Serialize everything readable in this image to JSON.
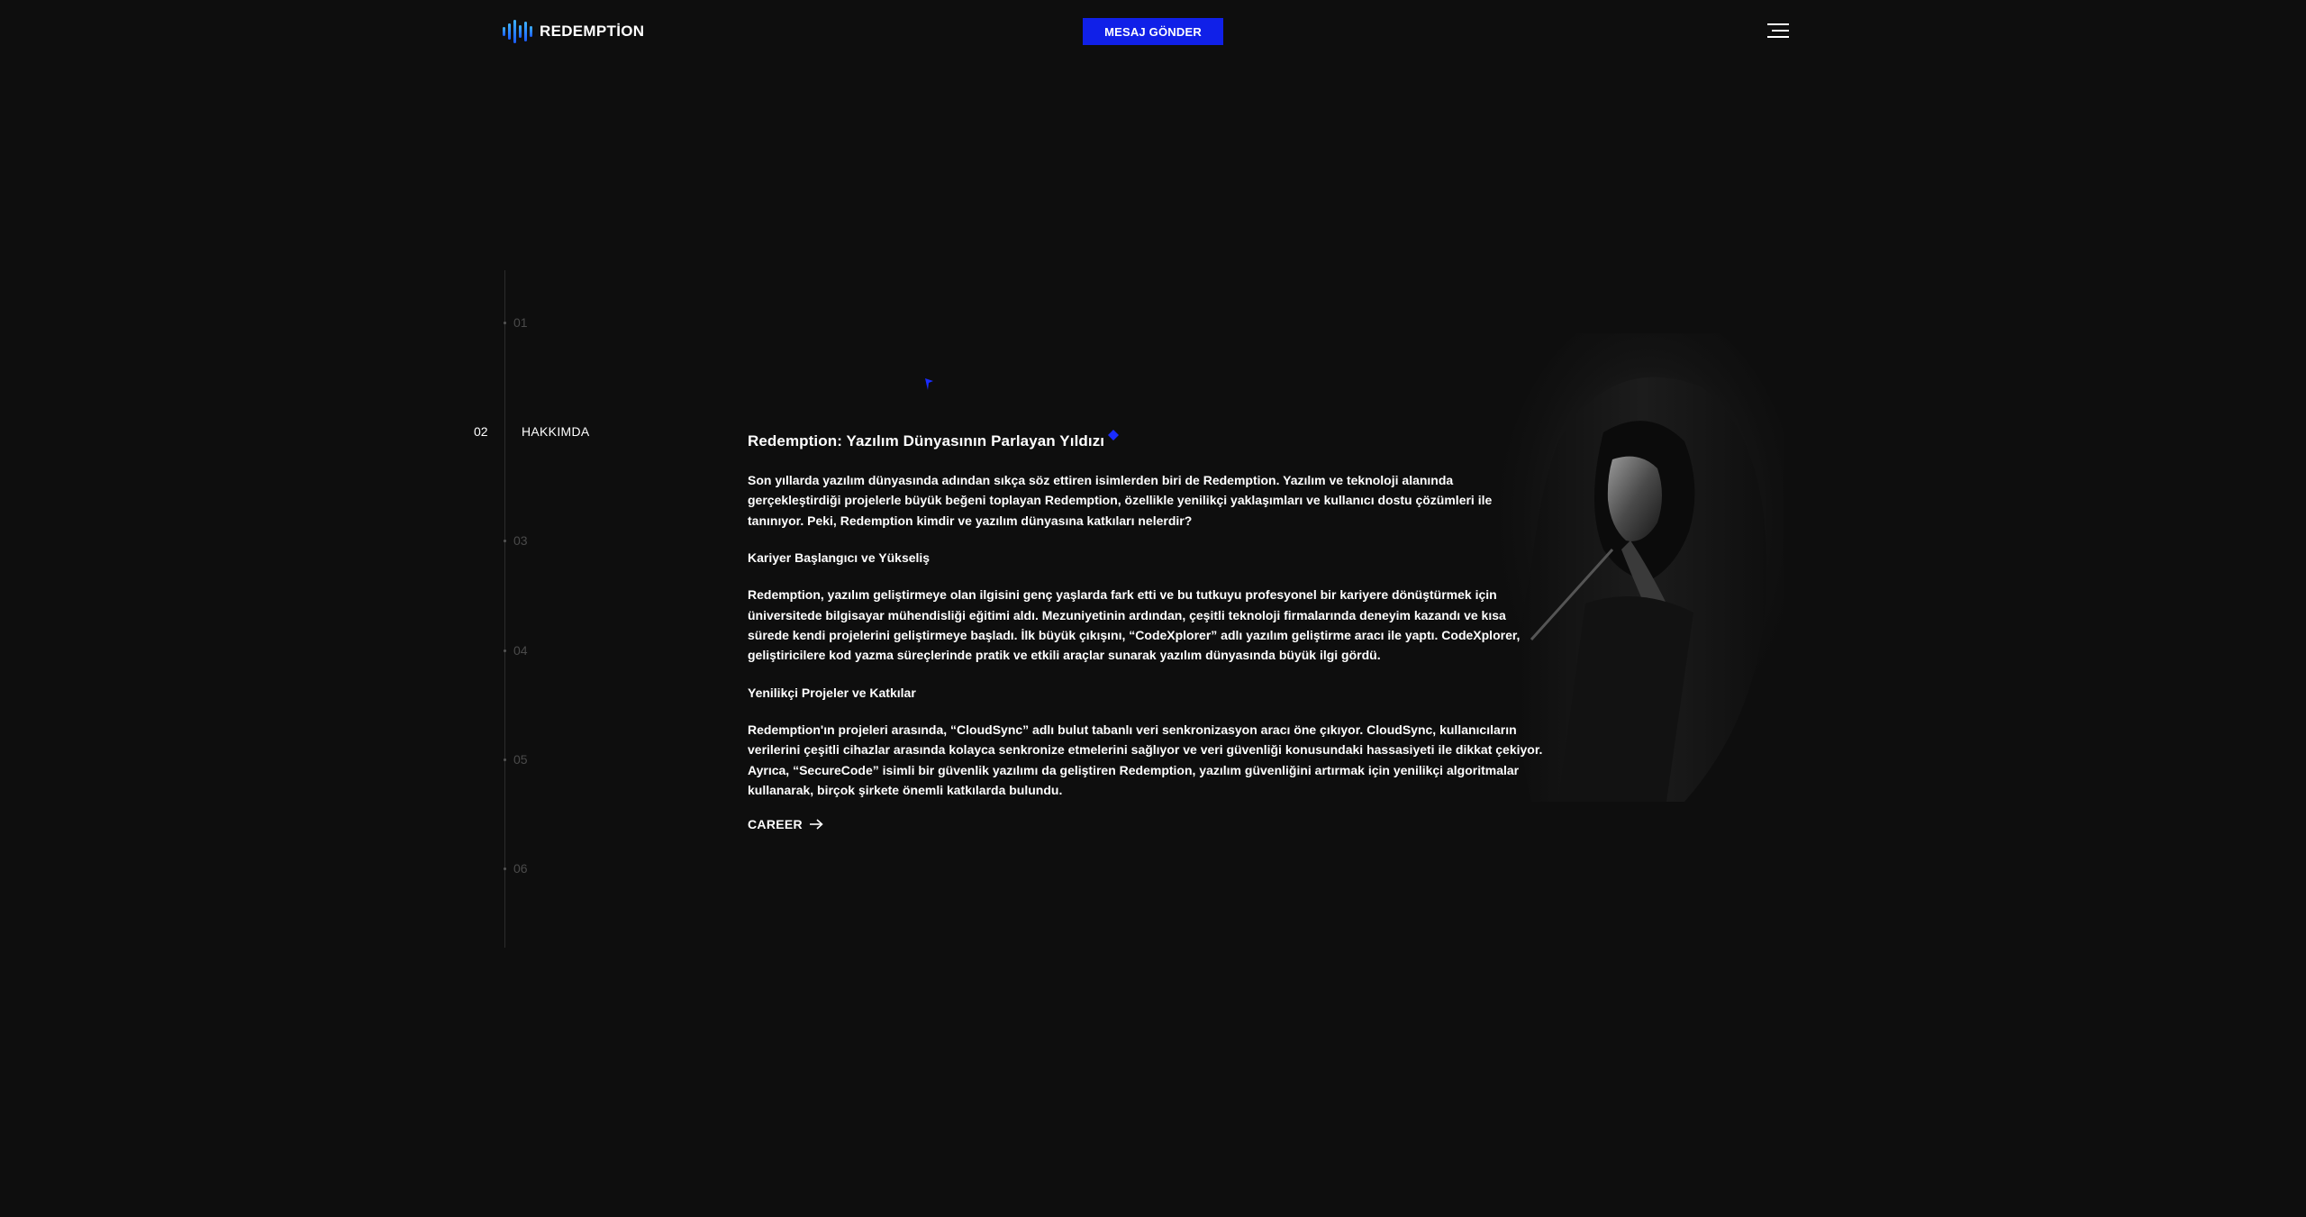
{
  "header": {
    "logo_text": "REDEMPTİON",
    "cta_label": "MESAJ GÖNDER"
  },
  "timeline": {
    "items": [
      {
        "num": "01",
        "label": ""
      },
      {
        "num": "02",
        "label": "HAKKIMDA"
      },
      {
        "num": "03",
        "label": ""
      },
      {
        "num": "04",
        "label": ""
      },
      {
        "num": "05",
        "label": ""
      },
      {
        "num": "06",
        "label": ""
      }
    ],
    "active_index": 1
  },
  "article": {
    "title": "Redemption: Yazılım Dünyasının Parlayan Yıldızı",
    "intro": {
      "pre": "Son yıllarda yazılım dünyasında adından sıkça söz ettiren isimlerden biri de ",
      "strong": "Redemption",
      "post": ". Yazılım ve teknoloji alanında gerçekleştirdiği projelerle büyük beğeni toplayan Redemption, özellikle yenilikçi yaklaşımları ve kullanıcı dostu çözümleri ile tanınıyor. Peki, Redemption kimdir ve yazılım dünyasına katkıları nelerdir?"
    },
    "section1_title": "Kariyer Başlangıcı ve Yükseliş",
    "section1_text": {
      "pre": "Redemption, yazılım geliştirmeye olan ilgisini genç yaşlarda fark etti ve bu tutkuyu profesyonel bir kariyere dönüştürmek için üniversitede bilgisayar mühendisliği eğitimi aldı. Mezuniyetinin ardından, çeşitli teknoloji firmalarında deneyim kazandı ve kısa sürede kendi projelerini geliştirmeye başladı. İlk büyük çıkışını, ",
      "strong": "“CodeXplorer”",
      "post": " adlı yazılım geliştirme aracı ile yaptı. CodeXplorer, geliştiricilere kod yazma süreçlerinde pratik ve etkili araçlar sunarak yazılım dünyasında büyük ilgi gördü."
    },
    "section2_title": "Yenilikçi Projeler ve Katkılar",
    "section2_text": {
      "pre": "Redemption'ın projeleri arasında, ",
      "strong1": "“CloudSync”",
      "mid": " adlı bulut tabanlı veri senkronizasyon aracı öne çıkıyor. CloudSync, kullanıcıların verilerini çeşitli cihazlar arasında kolayca senkronize etmelerini sağlıyor ve veri güvenliği konusundaki hassasiyeti ile dikkat çekiyor. Ayrıca, ",
      "strong2": "“SecureCode”",
      "post": " isimli bir güvenlik yazılımı da geliştiren Redemption, yazılım güvenliğini artırmak için yenilikçi algoritmalar kullanarak, birçok şirkete önemli katkılarda bulundu."
    },
    "career_label": "CAREER"
  },
  "colors": {
    "background": "#0e0e0e",
    "accent": "#1020e8",
    "logo_gradient_top": "#3fb3ff",
    "logo_gradient_bottom": "#1a5cff",
    "timeline_muted": "#4a4a4a"
  },
  "icons": {
    "logo": "soundwave-logo-icon",
    "menu": "hamburger-menu-icon",
    "career_arrow": "arrow-right-icon"
  }
}
